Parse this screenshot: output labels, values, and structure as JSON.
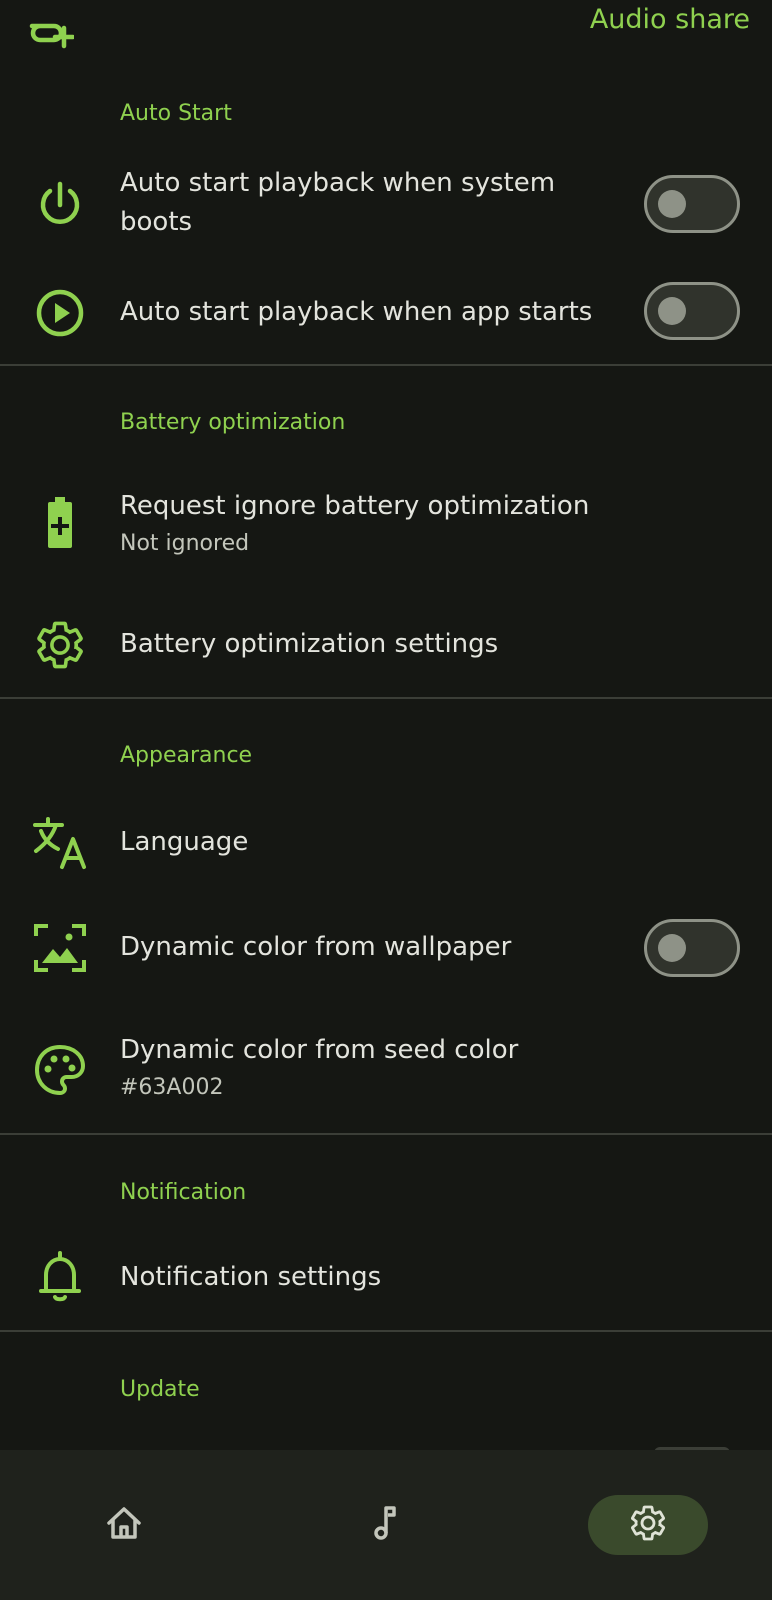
{
  "app": {
    "title": "Audio share",
    "icon": "audio-share-logo-icon",
    "accent_color": "#8fd14f"
  },
  "sections": {
    "auto_start": {
      "header": "Auto Start",
      "boot": {
        "title_line1": "Auto start playback when system",
        "title_line2": "boots",
        "icon": "power-icon",
        "enabled": false
      },
      "app_start": {
        "title": "Auto start playback when app starts",
        "icon": "play-circle-icon",
        "enabled": false
      }
    },
    "battery": {
      "header": "Battery optimization",
      "ignore": {
        "title": "Request ignore battery optimization",
        "subtitle": "Not ignored",
        "icon": "battery-plus-icon"
      },
      "settings": {
        "title": "Battery optimization settings",
        "icon": "gear-icon"
      }
    },
    "appearance": {
      "header": "Appearance",
      "language": {
        "title": "Language",
        "icon": "translate-icon"
      },
      "dynamic_wallpaper": {
        "title": "Dynamic color from wallpaper",
        "icon": "wallpaper-icon",
        "enabled": false
      },
      "dynamic_seed": {
        "title": "Dynamic color from seed color",
        "subtitle": "#63A002",
        "icon": "palette-icon"
      }
    },
    "notification": {
      "header": "Notification",
      "settings": {
        "title": "Notification settings",
        "icon": "bell-icon"
      }
    },
    "update": {
      "header": "Update"
    }
  },
  "bottom_nav": {
    "items": [
      {
        "icon": "home-icon",
        "active": false
      },
      {
        "icon": "music-note-icon",
        "active": false
      },
      {
        "icon": "settings-gear-icon",
        "active": true
      }
    ]
  }
}
